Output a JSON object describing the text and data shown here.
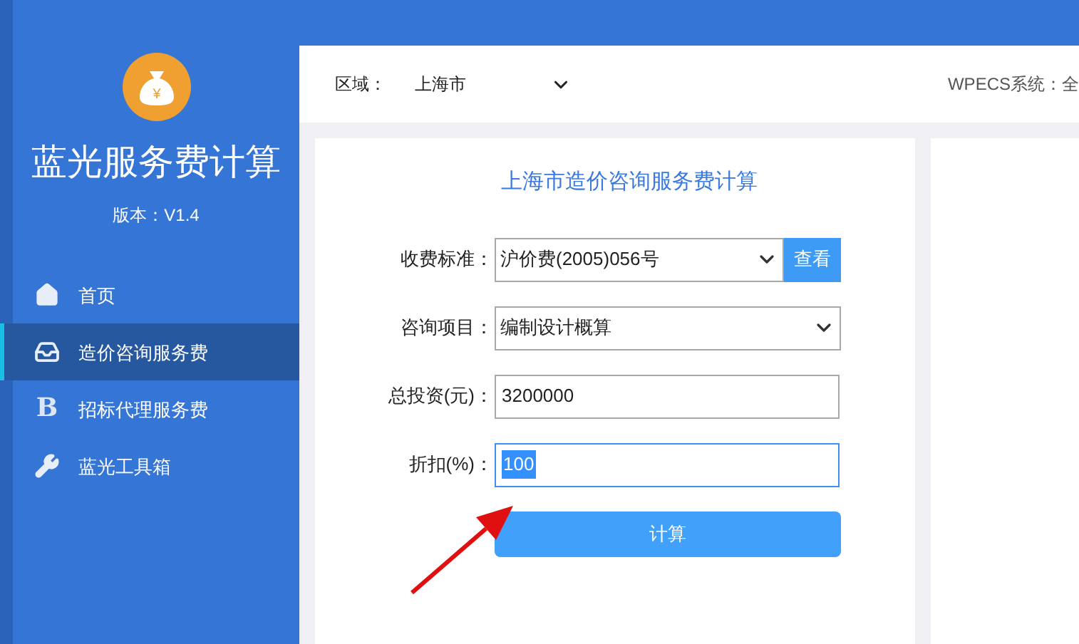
{
  "sidebar": {
    "logo_symbol": "¥",
    "app_title": "蓝光服务费计算",
    "version": "版本：V1.4",
    "items": [
      {
        "kind": "home",
        "label": "首页",
        "selected": false
      },
      {
        "kind": "inbox",
        "label": "造价咨询服务费",
        "selected": true
      },
      {
        "kind": "letter",
        "icon_text": "B",
        "label": "招标代理服务费",
        "selected": false
      },
      {
        "kind": "wrench",
        "label": "蓝光工具箱",
        "selected": false
      }
    ]
  },
  "header": {
    "region_label": "区域：",
    "region_value": "上海市",
    "system_text": "WPECS系统：全"
  },
  "form": {
    "title": "上海市造价咨询服务费计算",
    "fields": [
      {
        "kind": "select_button",
        "label": "收费标准：",
        "value": "沪价费(2005)056号",
        "button": "查看",
        "focused": false
      },
      {
        "kind": "select",
        "label": "咨询项目：",
        "value": "编制设计概算",
        "focused": false
      },
      {
        "kind": "input",
        "label": "总投资(元)：",
        "value": "3200000",
        "focused": false
      },
      {
        "kind": "input",
        "label": "折扣(%)：",
        "value": "100",
        "focused": true
      }
    ],
    "submit": "计算"
  }
}
